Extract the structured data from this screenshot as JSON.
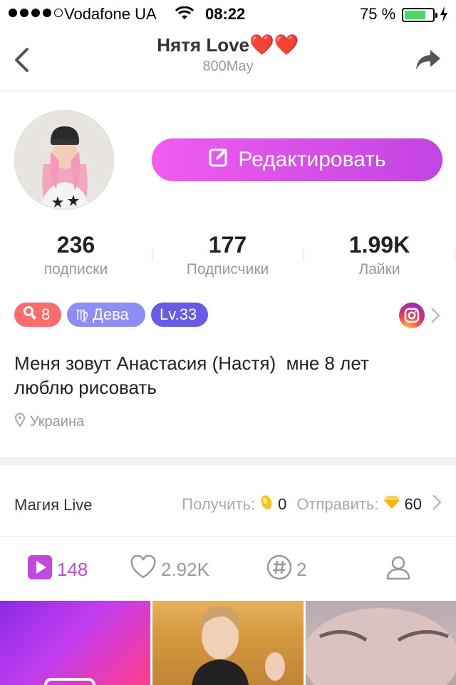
{
  "status_bar": {
    "carrier": "Vodafone UA",
    "time": "08:22",
    "battery": "75 %",
    "battery_level": 0.75
  },
  "nav": {
    "title": "Нятя Love",
    "hearts": "❤️❤️",
    "subtitle": "800May"
  },
  "profile": {
    "edit_label": "Редактировать",
    "stats": [
      {
        "value": "236",
        "label": "подписки"
      },
      {
        "value": "177",
        "label": "Подписчики"
      },
      {
        "value": "1.99K",
        "label": "Лайки"
      }
    ],
    "badges": {
      "fans": "8",
      "zodiac": "Дева",
      "level": "Lv.33"
    },
    "bio_line1": "Меня зовут Анастасия (Настя)  мне 8 лет",
    "bio_line2": "люблю рисовать",
    "location": "Украина"
  },
  "magic": {
    "title": "Магия Live",
    "receive_label": "Получить:",
    "receive_value": "0",
    "send_label": "Отправить:",
    "send_value": "60"
  },
  "tabs": [
    {
      "icon": "video-icon",
      "value": "148"
    },
    {
      "icon": "heart-icon",
      "value": "2.92K"
    },
    {
      "icon": "hashtag-icon",
      "value": "2"
    },
    {
      "icon": "person-icon",
      "value": ""
    }
  ],
  "colors": {
    "accent": "#c248df",
    "fans_badge": "#ff6b6b",
    "zodiac_badge": "#8d8ef5",
    "level_badge": "#6a5ae8"
  }
}
